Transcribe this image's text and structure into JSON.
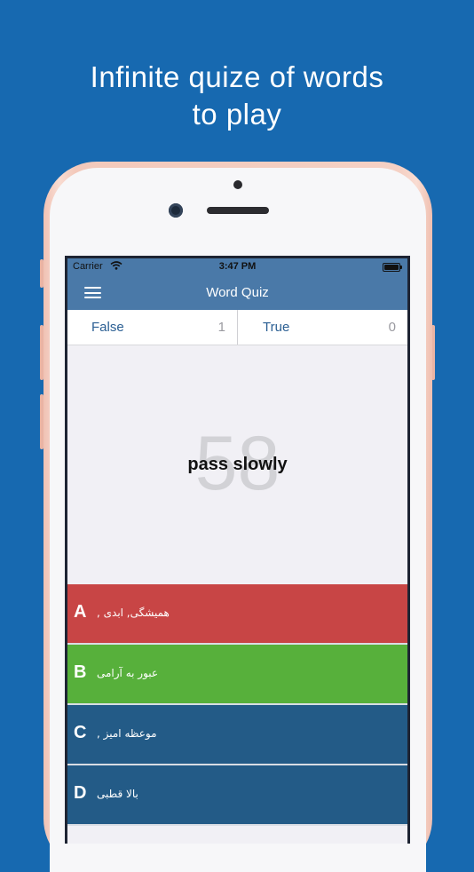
{
  "headline": {
    "line1": "Infinite quize of words",
    "line2": "to play"
  },
  "status_bar": {
    "carrier": "Carrier",
    "time": "3:47 PM"
  },
  "navbar": {
    "title": "Word Quiz"
  },
  "score": {
    "false_label": "False",
    "false_count": "1",
    "true_label": "True",
    "true_count": "0"
  },
  "question": {
    "timer": "58",
    "word": "pass slowly"
  },
  "answers": [
    {
      "letter": "A",
      "text": "همیشگی, ابدی ,",
      "color": "#c84545"
    },
    {
      "letter": "B",
      "text": "عبور به آرامی",
      "color": "#57b03b"
    },
    {
      "letter": "C",
      "text": "موعظه امیز ,",
      "color": "#235b87"
    },
    {
      "letter": "D",
      "text": "بالا قطبی",
      "color": "#235b87"
    }
  ],
  "colors": {
    "background": "#1769b0",
    "navbar": "#4a79a8",
    "phone_frame": "#f5d1c5"
  }
}
